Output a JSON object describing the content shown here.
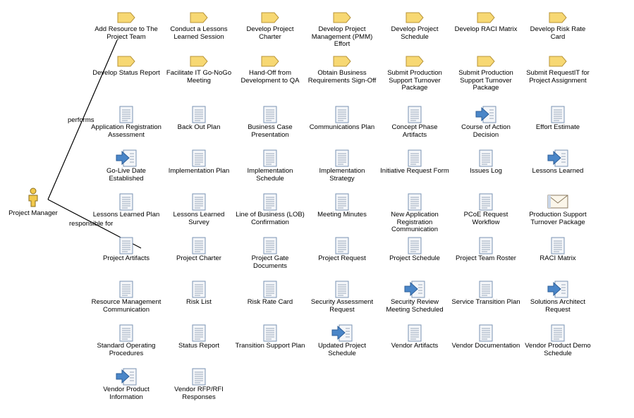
{
  "actor": {
    "label": "Project Manager",
    "icon": "person-icon"
  },
  "relations": {
    "performs": "performs",
    "responsible_for": "responsible for"
  },
  "tasks": [
    "Add Resource to The Project Team",
    "Conduct a Lessons Learned Session",
    "Develop Project Charter",
    "Develop Project Management (PMM) Effort",
    "Develop Project Schedule",
    "Develop RACI Matrix",
    "Develop Risk Rate Card",
    "Develop Status Report",
    "Facilitate IT Go-NoGo Meeting",
    "Hand-Off from Development to QA",
    "Obtain Business Requirements Sign-Off",
    "Submit Production Support Turnover Package",
    "Submit Production Support Turnover Package",
    "Submit RequestIT for Project Assignment"
  ],
  "artifacts": [
    {
      "label": "Application Registration Assessment",
      "icon": "document-icon"
    },
    {
      "label": "Back Out Plan",
      "icon": "document-icon"
    },
    {
      "label": "Business Case Presentation",
      "icon": "document-icon"
    },
    {
      "label": "Communications Plan",
      "icon": "document-icon"
    },
    {
      "label": "Concept Phase Artifacts",
      "icon": "document-icon"
    },
    {
      "label": "Course of Action Decision",
      "icon": "event-document-icon"
    },
    {
      "label": "Effort Estimate",
      "icon": "document-icon"
    },
    {
      "label": "Go-Live Date Established",
      "icon": "event-document-icon"
    },
    {
      "label": "Implementation Plan",
      "icon": "document-icon"
    },
    {
      "label": "Implementation Schedule",
      "icon": "document-icon"
    },
    {
      "label": "Implementation Strategy",
      "icon": "document-icon"
    },
    {
      "label": "Initiative Request Form",
      "icon": "document-icon"
    },
    {
      "label": "Issues Log",
      "icon": "document-icon"
    },
    {
      "label": "Lessons Learned",
      "icon": "event-document-icon"
    },
    {
      "label": "Lessons Learned Plan",
      "icon": "document-icon"
    },
    {
      "label": "Lessons Learned Survey",
      "icon": "document-icon"
    },
    {
      "label": "Line of Business (LOB) Confirmation",
      "icon": "document-icon"
    },
    {
      "label": "Meeting Minutes",
      "icon": "document-icon"
    },
    {
      "label": "New Application Registration Communication",
      "icon": "document-icon"
    },
    {
      "label": "PCoE Request Workflow",
      "icon": "document-icon"
    },
    {
      "label": "Production Support Turnover Package",
      "icon": "envelope-icon"
    },
    {
      "label": "Project Artifacts",
      "icon": "document-icon"
    },
    {
      "label": "Project Charter",
      "icon": "document-icon"
    },
    {
      "label": "Project Gate Documents",
      "icon": "document-icon"
    },
    {
      "label": "Project Request",
      "icon": "document-icon"
    },
    {
      "label": "Project Schedule",
      "icon": "document-icon"
    },
    {
      "label": "Project Team Roster",
      "icon": "document-icon"
    },
    {
      "label": "RACI Matrix",
      "icon": "document-icon"
    },
    {
      "label": "Resource Management Communication",
      "icon": "document-icon"
    },
    {
      "label": "Risk List",
      "icon": "document-icon"
    },
    {
      "label": "Risk Rate Card",
      "icon": "document-icon"
    },
    {
      "label": "Security Assessment Request",
      "icon": "document-icon"
    },
    {
      "label": "Security Review Meeting Scheduled",
      "icon": "event-document-icon"
    },
    {
      "label": "Service Transition Plan",
      "icon": "document-icon"
    },
    {
      "label": "Solutions Architect Request",
      "icon": "event-document-icon"
    },
    {
      "label": "Standard Operating Procedures",
      "icon": "document-icon"
    },
    {
      "label": "Status Report",
      "icon": "document-icon"
    },
    {
      "label": "Transition Support Plan",
      "icon": "document-icon"
    },
    {
      "label": "Updated Project Schedule",
      "icon": "event-document-icon"
    },
    {
      "label": "Vendor Artifacts",
      "icon": "document-icon"
    },
    {
      "label": "Vendor Documentation",
      "icon": "document-icon"
    },
    {
      "label": "Vendor Product Demo Schedule",
      "icon": "document-icon"
    },
    {
      "label": "Vendor Product Information",
      "icon": "event-document-icon"
    },
    {
      "label": "Vendor RFP/RFI Responses",
      "icon": "document-icon"
    }
  ],
  "colors": {
    "task_fill": "#f7d873",
    "task_stroke": "#b8953a",
    "doc_stroke": "#7a93b3",
    "arrow_fill": "#4a86c8",
    "person_fill": "#f2c94c"
  }
}
